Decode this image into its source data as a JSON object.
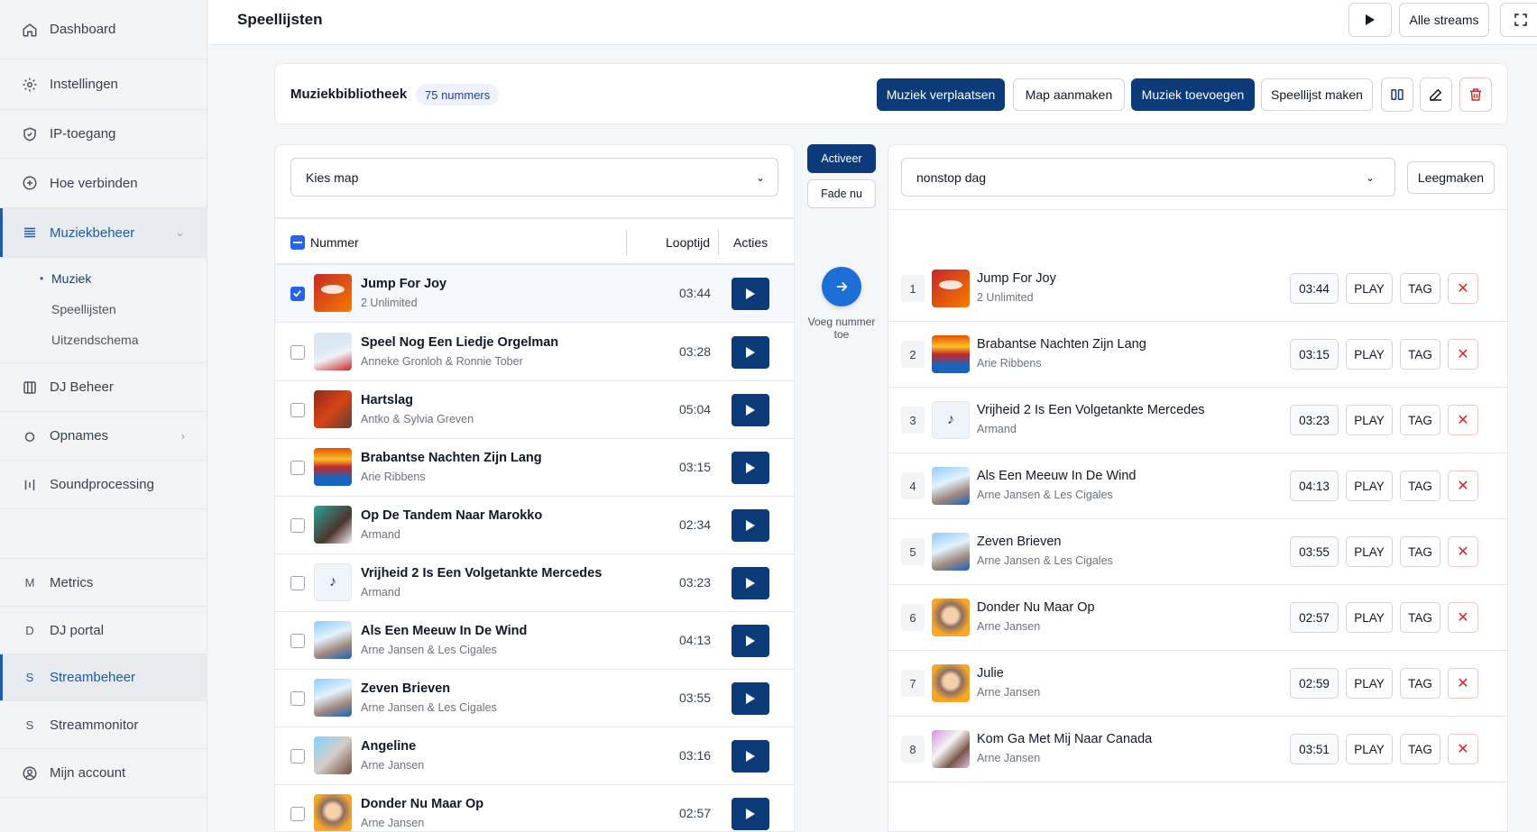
{
  "sidebar": {
    "items": [
      {
        "label": "Dashboard",
        "icon": "home-icon"
      },
      {
        "label": "Instellingen",
        "icon": "gear-icon"
      },
      {
        "label": "IP-toegang",
        "icon": "shield-icon"
      },
      {
        "label": "Hoe verbinden",
        "icon": "plus-circle-icon"
      },
      {
        "label": "Muziekbeheer",
        "icon": "list-icon",
        "active": true
      },
      {
        "label": "DJ Beheer",
        "icon": "columns-icon"
      },
      {
        "label": "Opnames",
        "icon": "record-icon"
      },
      {
        "label": "Soundprocessing",
        "icon": "equalizer-icon"
      },
      {
        "label": "Metrics",
        "letter": "M"
      },
      {
        "label": "DJ portal",
        "letter": "D"
      },
      {
        "label": "Streambeheer",
        "letter": "S",
        "active": true
      },
      {
        "label": "Streammonitor",
        "letter": "S"
      },
      {
        "label": "Mijn account",
        "icon": "user-circle-icon"
      }
    ],
    "sub_items": [
      "Muziek",
      "Speellijsten",
      "Uitzendschema"
    ]
  },
  "topbar": {
    "title": "Speellijsten",
    "all_streams": "Alle streams"
  },
  "library": {
    "title": "Muziekbibliotheek",
    "count": "75 nummers",
    "buttons": {
      "move": "Muziek verplaatsen",
      "new_folder": "Map aanmaken",
      "add_music": "Muziek toevoegen",
      "new_playlist": "Speellijst maken"
    }
  },
  "left": {
    "folder_select": "Kies map",
    "headers": {
      "track": "Nummer",
      "duration": "Looptijd",
      "actions": "Acties"
    },
    "tracks": [
      {
        "title": "Jump For Joy",
        "artist": "2 Unlimited",
        "duration": "03:44",
        "checked": true
      },
      {
        "title": "Speel Nog Een Liedje Orgelman",
        "artist": "Anneke Gronloh & Ronnie Tober",
        "duration": "03:28"
      },
      {
        "title": "Hartslag",
        "artist": "Antko & Sylvia Greven",
        "duration": "05:04"
      },
      {
        "title": "Brabantse Nachten Zijn Lang",
        "artist": "Arie Ribbens",
        "duration": "03:15"
      },
      {
        "title": "Op De Tandem Naar Marokko",
        "artist": "Armand",
        "duration": "02:34"
      },
      {
        "title": "Vrijheid 2 Is Een Volgetankte Mercedes",
        "artist": "Armand",
        "duration": "03:23"
      },
      {
        "title": "Als Een Meeuw In De Wind",
        "artist": "Arne Jansen & Les Cigales",
        "duration": "04:13"
      },
      {
        "title": "Zeven Brieven",
        "artist": "Arne Jansen & Les Cigales",
        "duration": "03:55"
      },
      {
        "title": "Angeline",
        "artist": "Arne Jansen",
        "duration": "03:16"
      },
      {
        "title": "Donder Nu Maar Op",
        "artist": "Arne Jansen",
        "duration": "02:57"
      }
    ]
  },
  "middle": {
    "activate": "Activeer",
    "fade": "Fade nu",
    "add_label": "Voeg nummer toe"
  },
  "right": {
    "playlist_select": "nonstop dag",
    "clear": "Leegmaken",
    "play_label": "PLAY",
    "tag_label": "TAG",
    "tracks": [
      {
        "n": "1",
        "title": "Jump For Joy",
        "artist": "2 Unlimited",
        "duration": "03:44"
      },
      {
        "n": "2",
        "title": "Brabantse Nachten Zijn Lang",
        "artist": "Arie Ribbens",
        "duration": "03:15"
      },
      {
        "n": "3",
        "title": "Vrijheid 2 Is Een Volgetankte Mercedes",
        "artist": "Armand",
        "duration": "03:23"
      },
      {
        "n": "4",
        "title": "Als Een Meeuw In De Wind",
        "artist": "Arne Jansen & Les Cigales",
        "duration": "04:13"
      },
      {
        "n": "5",
        "title": "Zeven Brieven",
        "artist": "Arne Jansen & Les Cigales",
        "duration": "03:55"
      },
      {
        "n": "6",
        "title": "Donder Nu Maar Op",
        "artist": "Arne Jansen",
        "duration": "02:57"
      },
      {
        "n": "7",
        "title": "Julie",
        "artist": "Arne Jansen",
        "duration": "02:59"
      },
      {
        "n": "8",
        "title": "Kom Ga Met Mij Naar Canada",
        "artist": "Arne Jansen",
        "duration": "03:51"
      }
    ]
  },
  "colors": {
    "primary": "#0d3a78",
    "accent": "#2563eb",
    "danger": "#dc2626"
  }
}
